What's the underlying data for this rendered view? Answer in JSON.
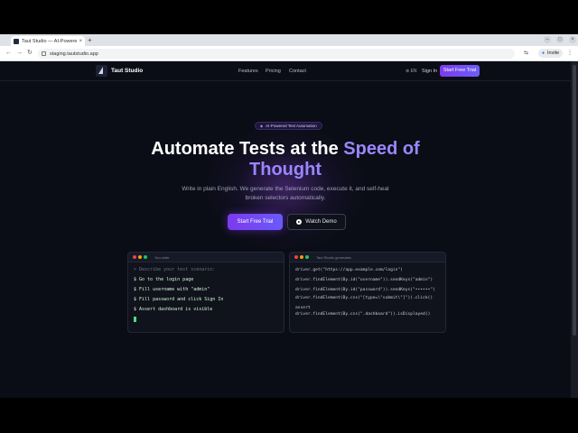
{
  "browser": {
    "tab_title": "Taut Studio — AI-Powered",
    "url": "staging.tautstudio.app",
    "invite_label": "Invite",
    "new_tab": "+",
    "close": "×"
  },
  "nav": {
    "brand": "Taut Studio",
    "links": [
      "Features",
      "Pricing",
      "Contact"
    ],
    "lang": "⊕ EN",
    "signin": "Sign In",
    "cta": "Start Free Trial"
  },
  "hero": {
    "badge": "AI-Powered Test Automation",
    "title_plain": "Automate Tests at the ",
    "title_accent": "Speed of Thought",
    "subtitle": "Write in plain English. We generate the Selenium code, execute it, and self-heal broken selectors automatically.",
    "primary_cta": "Start Free Trial",
    "secondary_cta": "Watch Demo"
  },
  "editor_left": {
    "label": "You write",
    "comment": "> Describe your test scenario:",
    "steps": [
      "$ Go to the login page",
      "$ Fill username with \"admin\"",
      "$ Fill password and click Sign In",
      "$ Assert dashboard is visible"
    ]
  },
  "editor_right": {
    "label": "Taut Studio generates",
    "lines": [
      "driver.get(\"https://app.example.com/login\")",
      "driver.findElement(By.id(\"username\")).sendKeys(\"admin\")",
      "driver.findElement(By.id(\"password\")).sendKeys(\"••••••\")",
      "driver.findElement(By.css(\"[type=\\\"submit\\\"]\")).click()",
      "assert",
      "driver.findElement(By.css(\".dashboard\")).isDisplayed()"
    ]
  },
  "colors": {
    "accent": "#9a86ff",
    "cta": "#7c3aed",
    "background": "#0b0d16"
  }
}
